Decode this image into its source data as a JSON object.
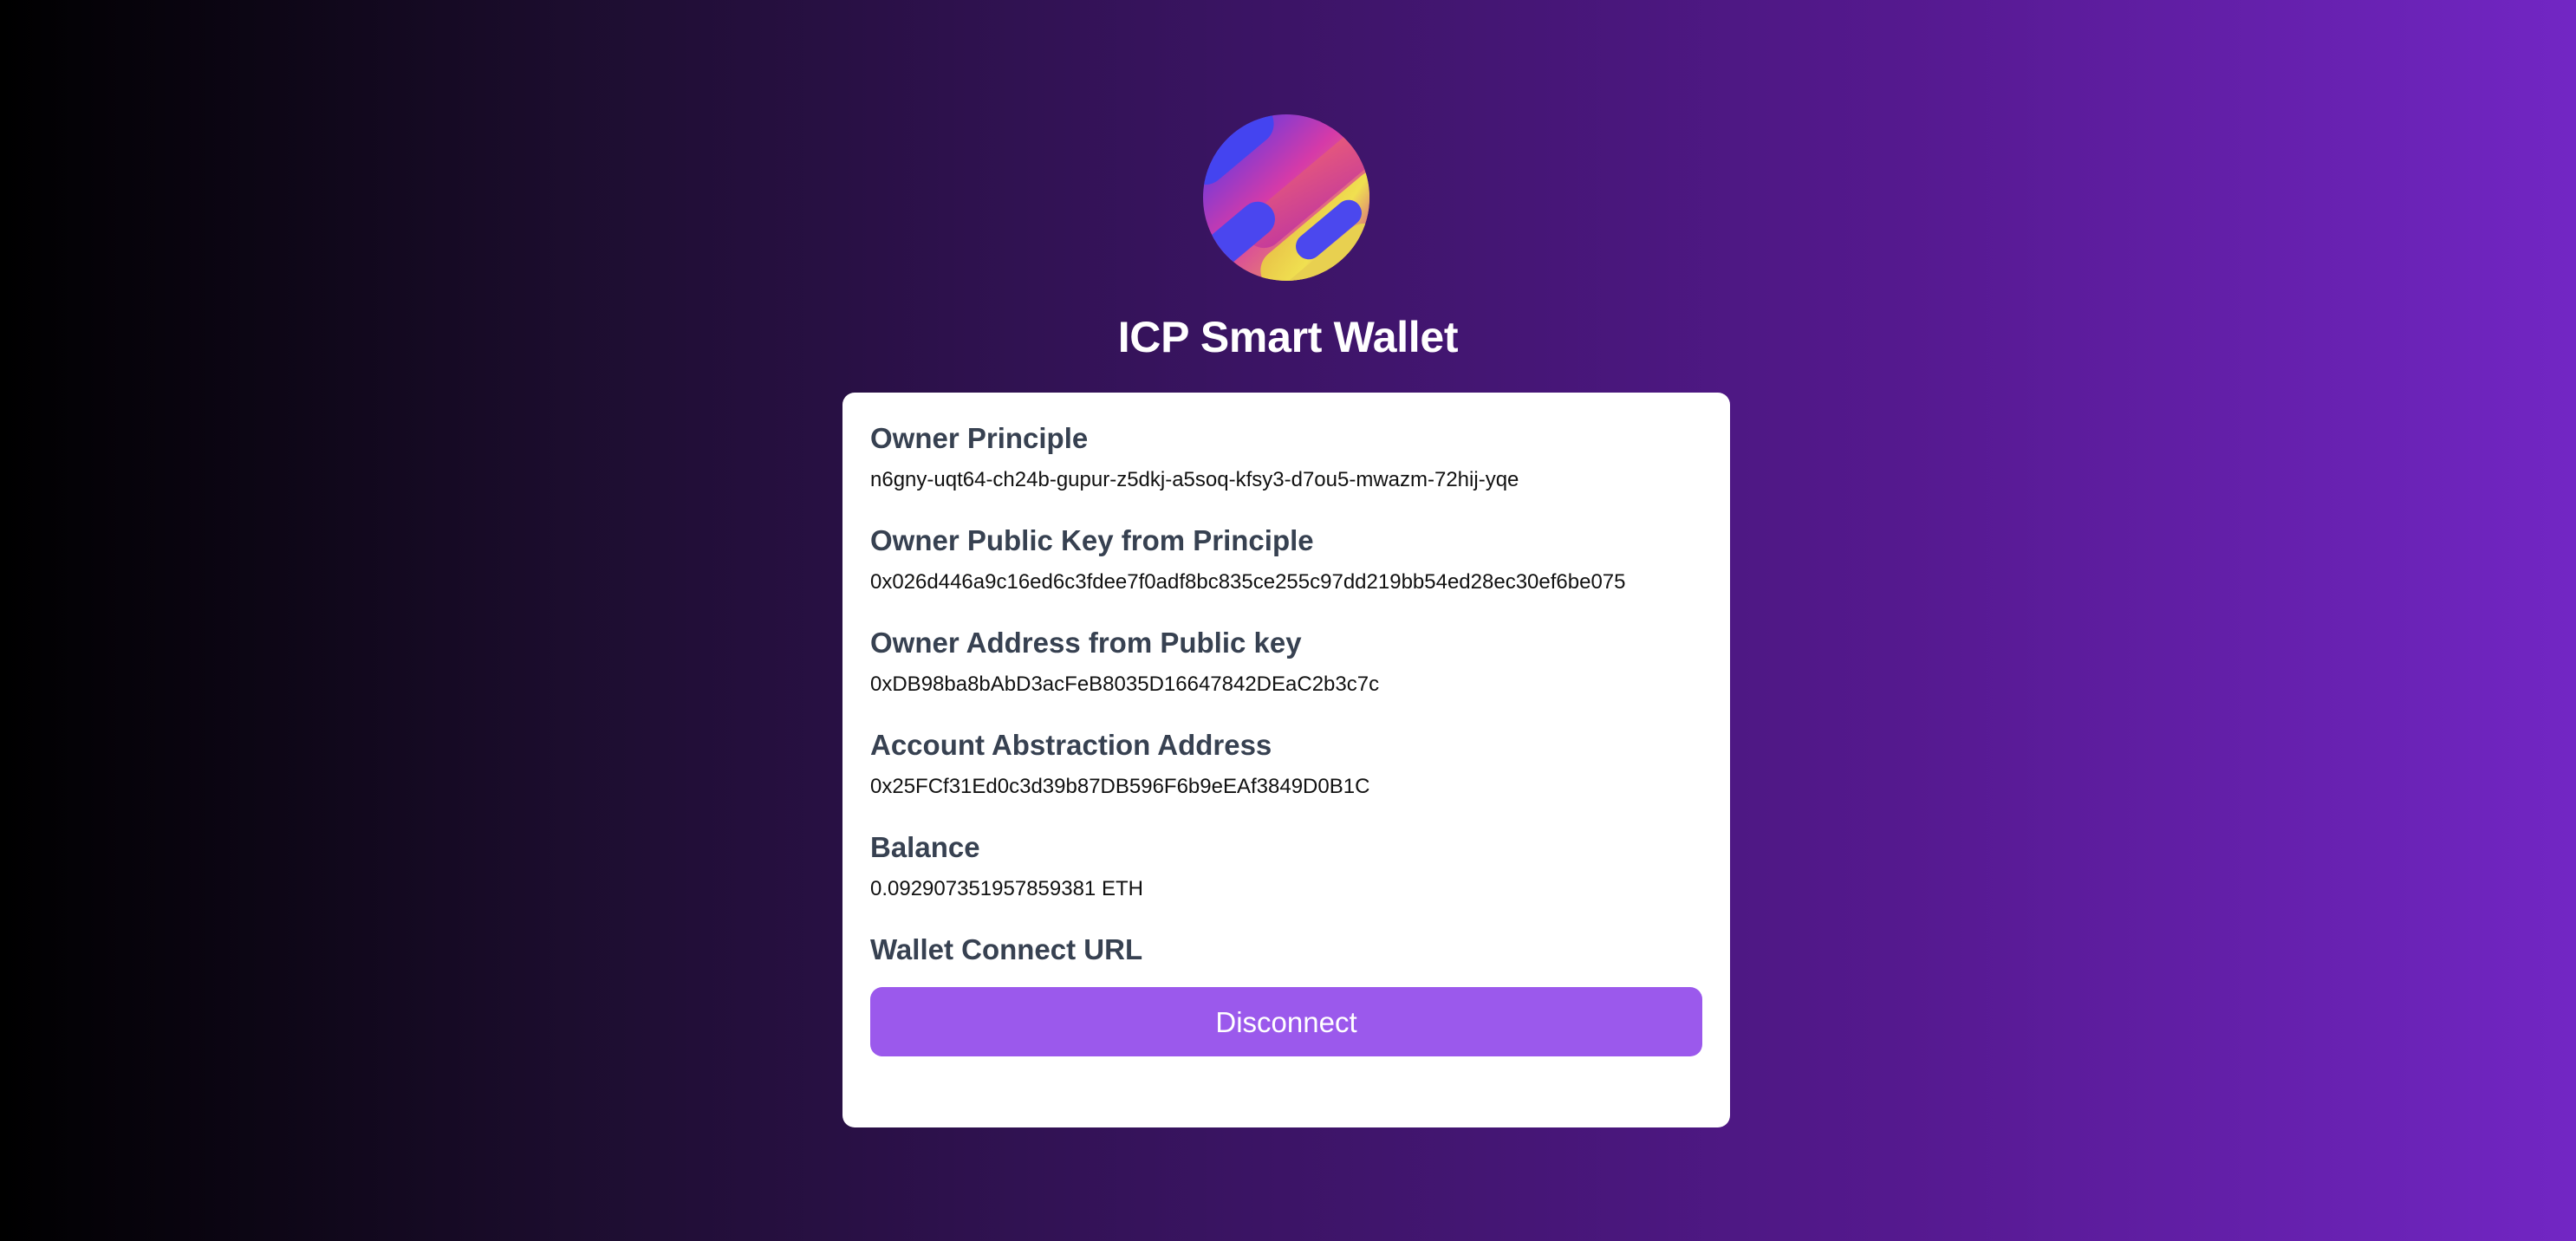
{
  "header": {
    "logo_icon": "icp-gradient-logo-icon",
    "title": "ICP Smart Wallet"
  },
  "card": {
    "owner_principle": {
      "label": "Owner Principle",
      "value": "n6gny-uqt64-ch24b-gupur-z5dkj-a5soq-kfsy3-d7ou5-mwazm-72hij-yqe"
    },
    "owner_public_key": {
      "label": "Owner Public Key from Principle",
      "value": "0x026d446a9c16ed6c3fdee7f0adf8bc835ce255c97dd219bb54ed28ec30ef6be075"
    },
    "owner_address": {
      "label": "Owner Address from Public key",
      "value": "0xDB98ba8bAbD3acFeB8035D16647842DEaC2b3c7c"
    },
    "account_abstraction_address": {
      "label": "Account Abstraction Address",
      "value": "0x25FCf31Ed0c3d39b87DB596F6b9eEAf3849D0B1C"
    },
    "balance": {
      "label": "Balance",
      "value": "0.092907351957859381 ETH"
    },
    "wallet_connect": {
      "label": "Wallet Connect URL"
    },
    "disconnect_label": "Disconnect"
  },
  "colors": {
    "background_start": "#000000",
    "background_end": "#7226c4",
    "button": "#9b59ec",
    "label_text": "#374151"
  }
}
